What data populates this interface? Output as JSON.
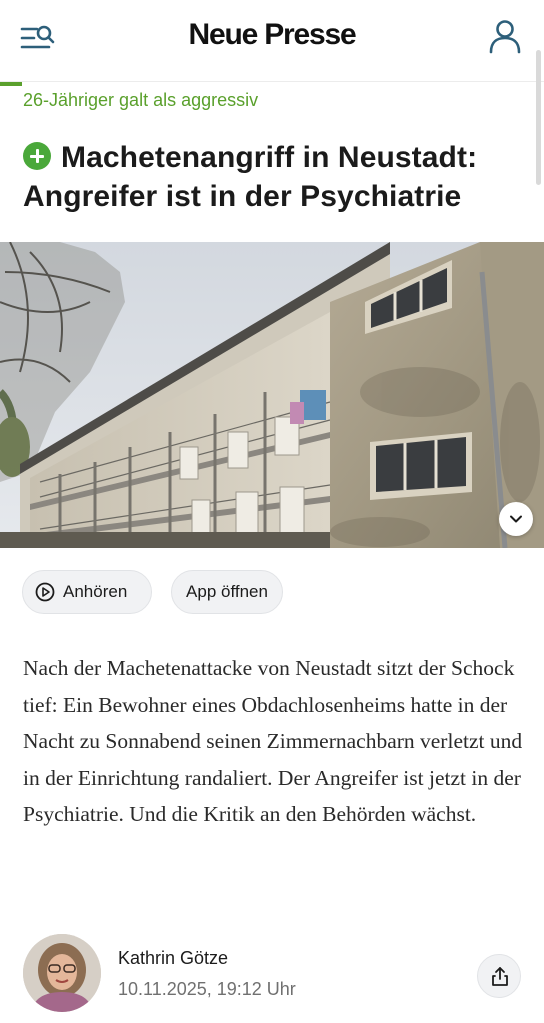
{
  "header": {
    "logo": "Neue Presse",
    "menu_icon": "menu-search-icon",
    "profile_icon": "user-icon"
  },
  "reading_progress": 0.04,
  "article": {
    "kicker": "26-Jähriger galt als aggressiv",
    "headline_icon": "plus-circle-icon",
    "headline": "Machetenangriff in Neustadt: Angreifer ist in der Psychiatrie",
    "image_icon": "chevron-down-icon",
    "actions": {
      "listen_label": "Anhören",
      "listen_icon": "play-circle-icon",
      "app_label": "App öffnen"
    },
    "lead": "Nach der Machetenattacke von Neustadt sitzt der Schock tief: Ein Bewohner eines Obdachlosenheims hatte in der Nacht zu Sonnabend seinen Zimmernachbarn verletzt und in der Einrichtung randaliert. Der Angreifer ist jetzt in der Psychiatrie. Und die Kritik an den Behörden wächst.",
    "author": {
      "name": "Kathrin Götze",
      "date": "10.11.2025, 19:12 Uhr",
      "share_icon": "share-icon"
    }
  },
  "colors": {
    "accent": "#5aa02c",
    "text": "#1c1c1c",
    "muted": "#707070"
  }
}
